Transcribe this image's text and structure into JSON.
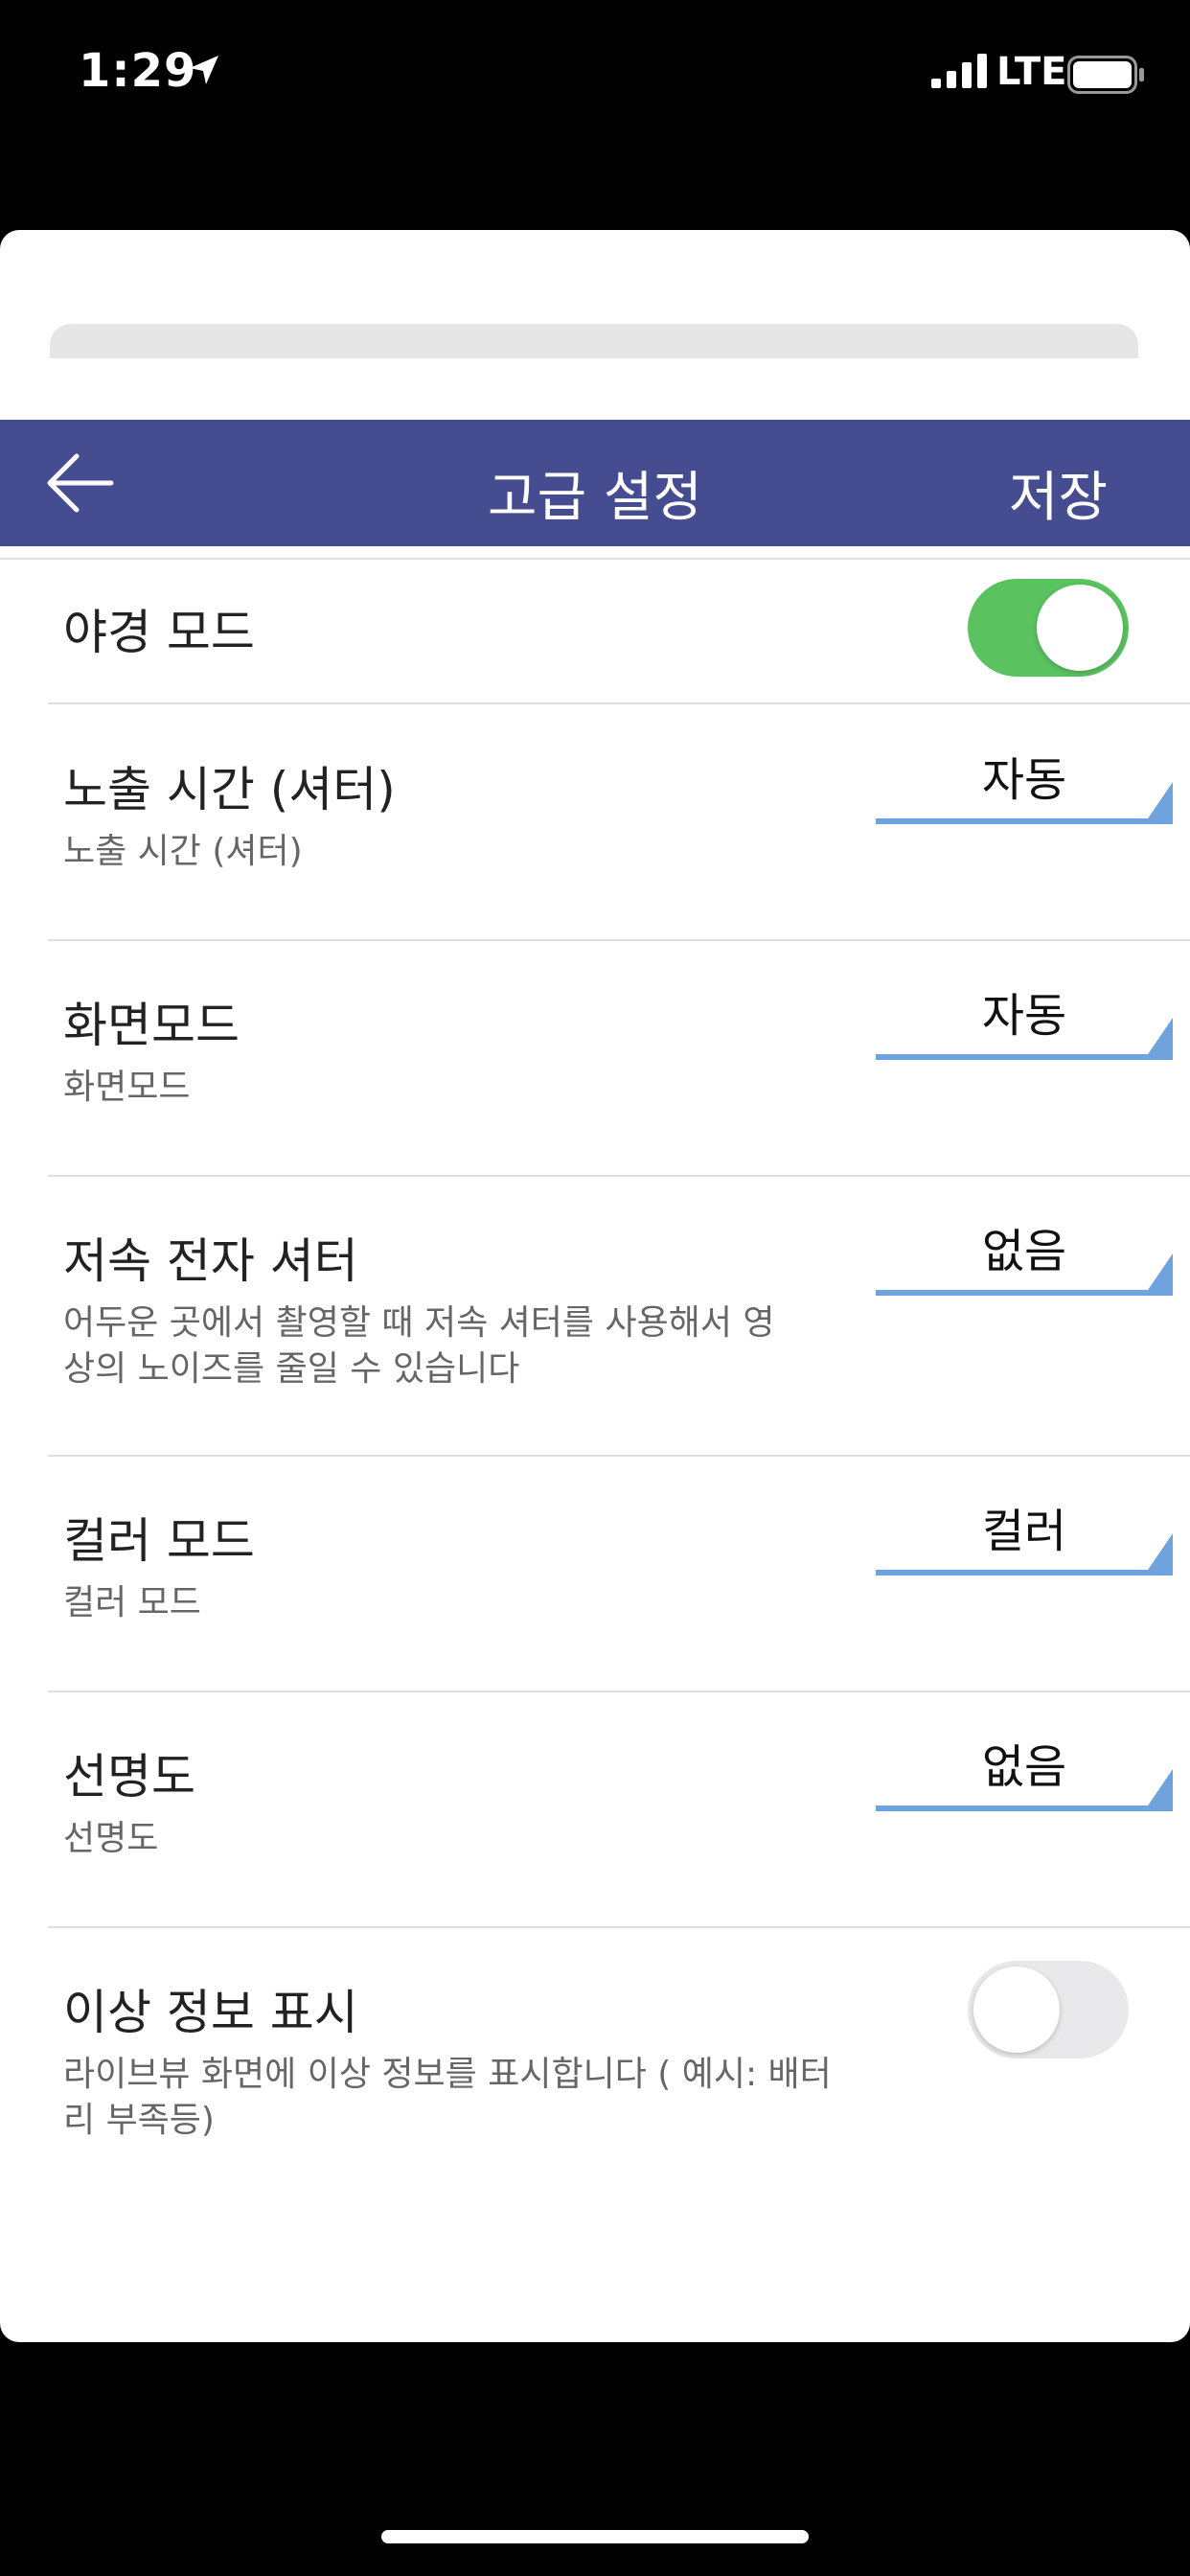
{
  "status_bar": {
    "time": "1:29",
    "carrier": "LTE"
  },
  "header": {
    "title": "고급 설정",
    "save_label": "저장"
  },
  "settings": {
    "night_mode": {
      "label": "야경 모드",
      "enabled": true
    },
    "exposure": {
      "label": "노출 시간 (셔터)",
      "description": "노출 시간 (셔터)",
      "value": "자동"
    },
    "screen_mode": {
      "label": "화면모드",
      "description": "화면모드",
      "value": "자동"
    },
    "slow_shutter": {
      "label": "저속 전자 셔터",
      "description_line1": "어두운 곳에서 촬영할 때 저속 셔터를 사용해서 영",
      "description_line2": "상의 노이즈를 줄일 수 있습니다",
      "value": "없음"
    },
    "color_mode": {
      "label": "컬러 모드",
      "description": "컬러 모드",
      "value": "컬러"
    },
    "sharpness": {
      "label": "선명도",
      "description": "선명도",
      "value": "없음"
    },
    "abnormal_info": {
      "label": "이상 정보 표시",
      "description_line1": "라이브뷰 화면에 이상 정보를 표시합니다 ( 예시: 배터",
      "description_line2": "리 부족등)",
      "enabled": false
    }
  },
  "colors": {
    "header_bg": "#464c90",
    "toggle_on": "#5ac25f",
    "select_accent": "#6ea3dd"
  }
}
